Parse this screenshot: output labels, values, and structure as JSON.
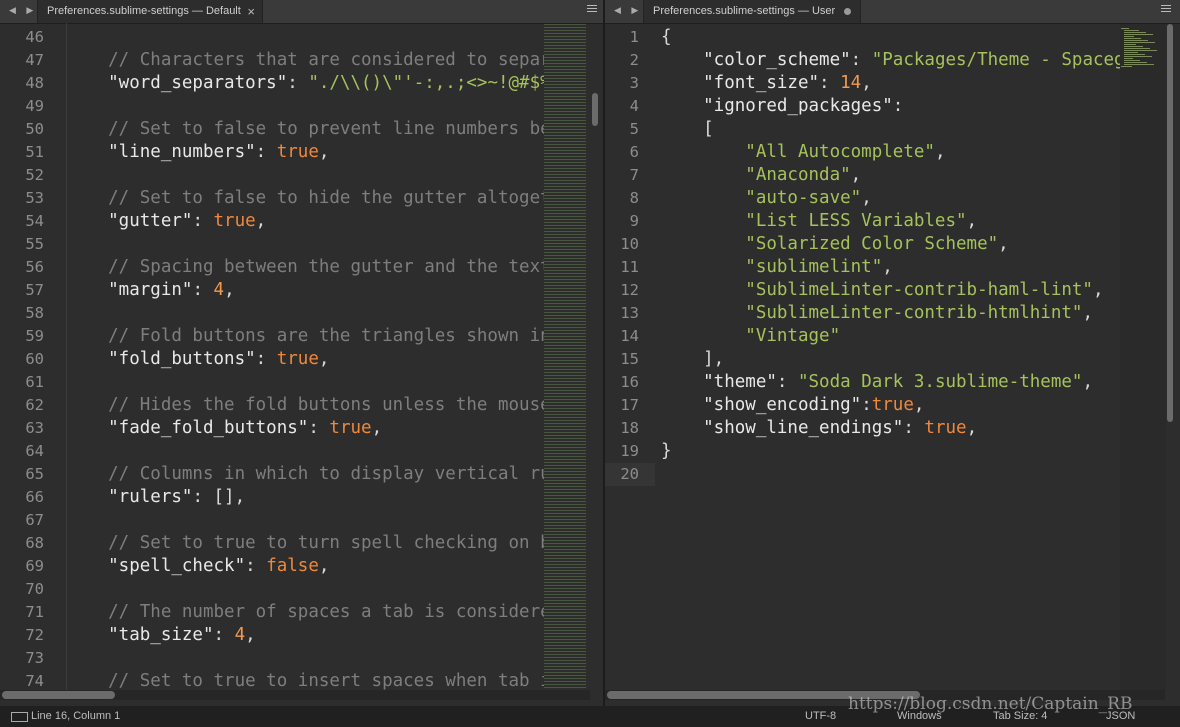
{
  "left_tab": {
    "title": "Preferences.sublime-settings — Default",
    "close": "×",
    "nav": "◀ ▶"
  },
  "right_tab": {
    "title": "Preferences.sublime-settings — User",
    "nav": "◀ ▶"
  },
  "left_lines": [
    {
      "n": "46",
      "t": []
    },
    {
      "n": "47",
      "t": [
        [
          "c-comment",
          "    // Characters that are considered to separ"
        ]
      ]
    },
    {
      "n": "48",
      "t": [
        [
          "c-key",
          "    \"word_separators\""
        ],
        [
          "c-punct",
          ": "
        ],
        [
          "c-str",
          "\"./\\\\()\\\"'-:,.;<>~!@#$%"
        ]
      ]
    },
    {
      "n": "49",
      "t": []
    },
    {
      "n": "50",
      "t": [
        [
          "c-comment",
          "    // Set to false to prevent line numbers be"
        ]
      ]
    },
    {
      "n": "51",
      "t": [
        [
          "c-key",
          "    \"line_numbers\""
        ],
        [
          "c-punct",
          ": "
        ],
        [
          "c-bool",
          "true"
        ],
        [
          "c-punct",
          ","
        ]
      ]
    },
    {
      "n": "52",
      "t": []
    },
    {
      "n": "53",
      "t": [
        [
          "c-comment",
          "    // Set to false to hide the gutter altoget"
        ]
      ]
    },
    {
      "n": "54",
      "t": [
        [
          "c-key",
          "    \"gutter\""
        ],
        [
          "c-punct",
          ": "
        ],
        [
          "c-bool",
          "true"
        ],
        [
          "c-punct",
          ","
        ]
      ]
    },
    {
      "n": "55",
      "t": []
    },
    {
      "n": "56",
      "t": [
        [
          "c-comment",
          "    // Spacing between the gutter and the text"
        ]
      ]
    },
    {
      "n": "57",
      "t": [
        [
          "c-key",
          "    \"margin\""
        ],
        [
          "c-punct",
          ": "
        ],
        [
          "c-num",
          "4"
        ],
        [
          "c-punct",
          ","
        ]
      ]
    },
    {
      "n": "58",
      "t": []
    },
    {
      "n": "59",
      "t": [
        [
          "c-comment",
          "    // Fold buttons are the triangles shown in"
        ]
      ]
    },
    {
      "n": "60",
      "t": [
        [
          "c-key",
          "    \"fold_buttons\""
        ],
        [
          "c-punct",
          ": "
        ],
        [
          "c-bool",
          "true"
        ],
        [
          "c-punct",
          ","
        ]
      ]
    },
    {
      "n": "61",
      "t": []
    },
    {
      "n": "62",
      "t": [
        [
          "c-comment",
          "    // Hides the fold buttons unless the mouse"
        ]
      ]
    },
    {
      "n": "63",
      "t": [
        [
          "c-key",
          "    \"fade_fold_buttons\""
        ],
        [
          "c-punct",
          ": "
        ],
        [
          "c-bool",
          "true"
        ],
        [
          "c-punct",
          ","
        ]
      ]
    },
    {
      "n": "64",
      "t": []
    },
    {
      "n": "65",
      "t": [
        [
          "c-comment",
          "    // Columns in which to display vertical ru"
        ]
      ]
    },
    {
      "n": "66",
      "t": [
        [
          "c-key",
          "    \"rulers\""
        ],
        [
          "c-punct",
          ": [],"
        ]
      ]
    },
    {
      "n": "67",
      "t": []
    },
    {
      "n": "68",
      "t": [
        [
          "c-comment",
          "    // Set to true to turn spell checking on b"
        ]
      ]
    },
    {
      "n": "69",
      "t": [
        [
          "c-key",
          "    \"spell_check\""
        ],
        [
          "c-punct",
          ": "
        ],
        [
          "c-bool",
          "false"
        ],
        [
          "c-punct",
          ","
        ]
      ]
    },
    {
      "n": "70",
      "t": []
    },
    {
      "n": "71",
      "t": [
        [
          "c-comment",
          "    // The number of spaces a tab is considere"
        ]
      ]
    },
    {
      "n": "72",
      "t": [
        [
          "c-key",
          "    \"tab_size\""
        ],
        [
          "c-punct",
          ": "
        ],
        [
          "c-num",
          "4"
        ],
        [
          "c-punct",
          ","
        ]
      ]
    },
    {
      "n": "73",
      "t": []
    },
    {
      "n": "74",
      "t": [
        [
          "c-comment",
          "    // Set to true to insert spaces when tab i"
        ]
      ]
    }
  ],
  "right_lines": [
    {
      "n": "1",
      "t": [
        [
          "c-punct",
          "{"
        ]
      ]
    },
    {
      "n": "2",
      "t": [
        [
          "c-key",
          "    \"color_scheme\""
        ],
        [
          "c-punct",
          ": "
        ],
        [
          "c-str",
          "\"Packages/Theme - Spaceg"
        ]
      ]
    },
    {
      "n": "3",
      "t": [
        [
          "c-key",
          "    \"font_size\""
        ],
        [
          "c-punct",
          ": "
        ],
        [
          "c-num",
          "14"
        ],
        [
          "c-punct",
          ","
        ]
      ]
    },
    {
      "n": "4",
      "t": [
        [
          "c-key",
          "    \"ignored_packages\""
        ],
        [
          "c-punct",
          ":"
        ]
      ]
    },
    {
      "n": "5",
      "t": [
        [
          "c-punct",
          "    ["
        ]
      ]
    },
    {
      "n": "6",
      "t": [
        [
          "c-str",
          "        \"All Autocomplete\""
        ],
        [
          "c-punct",
          ","
        ]
      ]
    },
    {
      "n": "7",
      "t": [
        [
          "c-str",
          "        \"Anaconda\""
        ],
        [
          "c-punct",
          ","
        ]
      ]
    },
    {
      "n": "8",
      "t": [
        [
          "c-str",
          "        \"auto-save\""
        ],
        [
          "c-punct",
          ","
        ]
      ]
    },
    {
      "n": "9",
      "t": [
        [
          "c-str",
          "        \"List LESS Variables\""
        ],
        [
          "c-punct",
          ","
        ]
      ]
    },
    {
      "n": "10",
      "t": [
        [
          "c-str",
          "        \"Solarized Color Scheme\""
        ],
        [
          "c-punct",
          ","
        ]
      ]
    },
    {
      "n": "11",
      "t": [
        [
          "c-str",
          "        \"sublimelint\""
        ],
        [
          "c-punct",
          ","
        ]
      ]
    },
    {
      "n": "12",
      "t": [
        [
          "c-str",
          "        \"SublimeLinter-contrib-haml-lint\""
        ],
        [
          "c-punct",
          ","
        ]
      ]
    },
    {
      "n": "13",
      "t": [
        [
          "c-str",
          "        \"SublimeLinter-contrib-htmlhint\""
        ],
        [
          "c-punct",
          ","
        ]
      ]
    },
    {
      "n": "14",
      "t": [
        [
          "c-str",
          "        \"Vintage\""
        ]
      ]
    },
    {
      "n": "15",
      "t": [
        [
          "c-punct",
          "    ],"
        ]
      ]
    },
    {
      "n": "16",
      "t": [
        [
          "c-key",
          "    \"theme\""
        ],
        [
          "c-punct",
          ": "
        ],
        [
          "c-str",
          "\"Soda Dark 3.sublime-theme\""
        ],
        [
          "c-punct",
          ","
        ]
      ]
    },
    {
      "n": "17",
      "t": [
        [
          "c-key",
          "    \"show_encoding\""
        ],
        [
          "c-punct",
          ":"
        ],
        [
          "c-bool",
          "true"
        ],
        [
          "c-punct",
          ","
        ]
      ]
    },
    {
      "n": "18",
      "t": [
        [
          "c-key",
          "    \"show_line_endings\""
        ],
        [
          "c-punct",
          ": "
        ],
        [
          "c-bool",
          "true"
        ],
        [
          "c-punct",
          ","
        ]
      ]
    },
    {
      "n": "19",
      "t": [
        [
          "c-punct",
          "}"
        ]
      ]
    },
    {
      "n": "20",
      "t": []
    }
  ],
  "status": {
    "position": "Line 16, Column 1",
    "encoding": "UTF-8",
    "line_endings": "Windows",
    "tab_size": "Tab Size: 4",
    "syntax": "JSON"
  },
  "watermark": "https://blog.csdn.net/Captain_RB"
}
